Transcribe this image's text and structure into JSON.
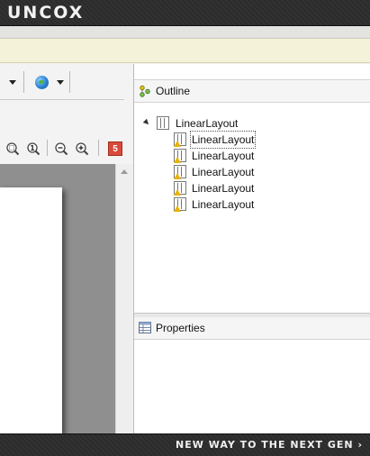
{
  "banner": {
    "logo_text": "UNCOX",
    "tagline": "NEW WAY TO THE NEXT GEN ›"
  },
  "editor": {
    "zoom_icons": [
      "zoom-fit-icon",
      "zoom-actual-size-icon",
      "zoom-out-icon",
      "zoom-in-icon"
    ],
    "badge_value": "5"
  },
  "outline": {
    "title": "Outline",
    "root": {
      "label": "LinearLayout",
      "expanded": true
    },
    "children": [
      {
        "label": "LinearLayout",
        "warning": true,
        "selected": true
      },
      {
        "label": "LinearLayout",
        "warning": true,
        "selected": false
      },
      {
        "label": "LinearLayout",
        "warning": true,
        "selected": false
      },
      {
        "label": "LinearLayout",
        "warning": true,
        "selected": false
      },
      {
        "label": "LinearLayout",
        "warning": true,
        "selected": false
      }
    ]
  },
  "properties": {
    "title": "Properties"
  },
  "colors": {
    "banner": "#2b2b2b",
    "info_bar": "#f4f2d9",
    "badge": "#d94a3a",
    "canvas": "#8f8f8f"
  }
}
